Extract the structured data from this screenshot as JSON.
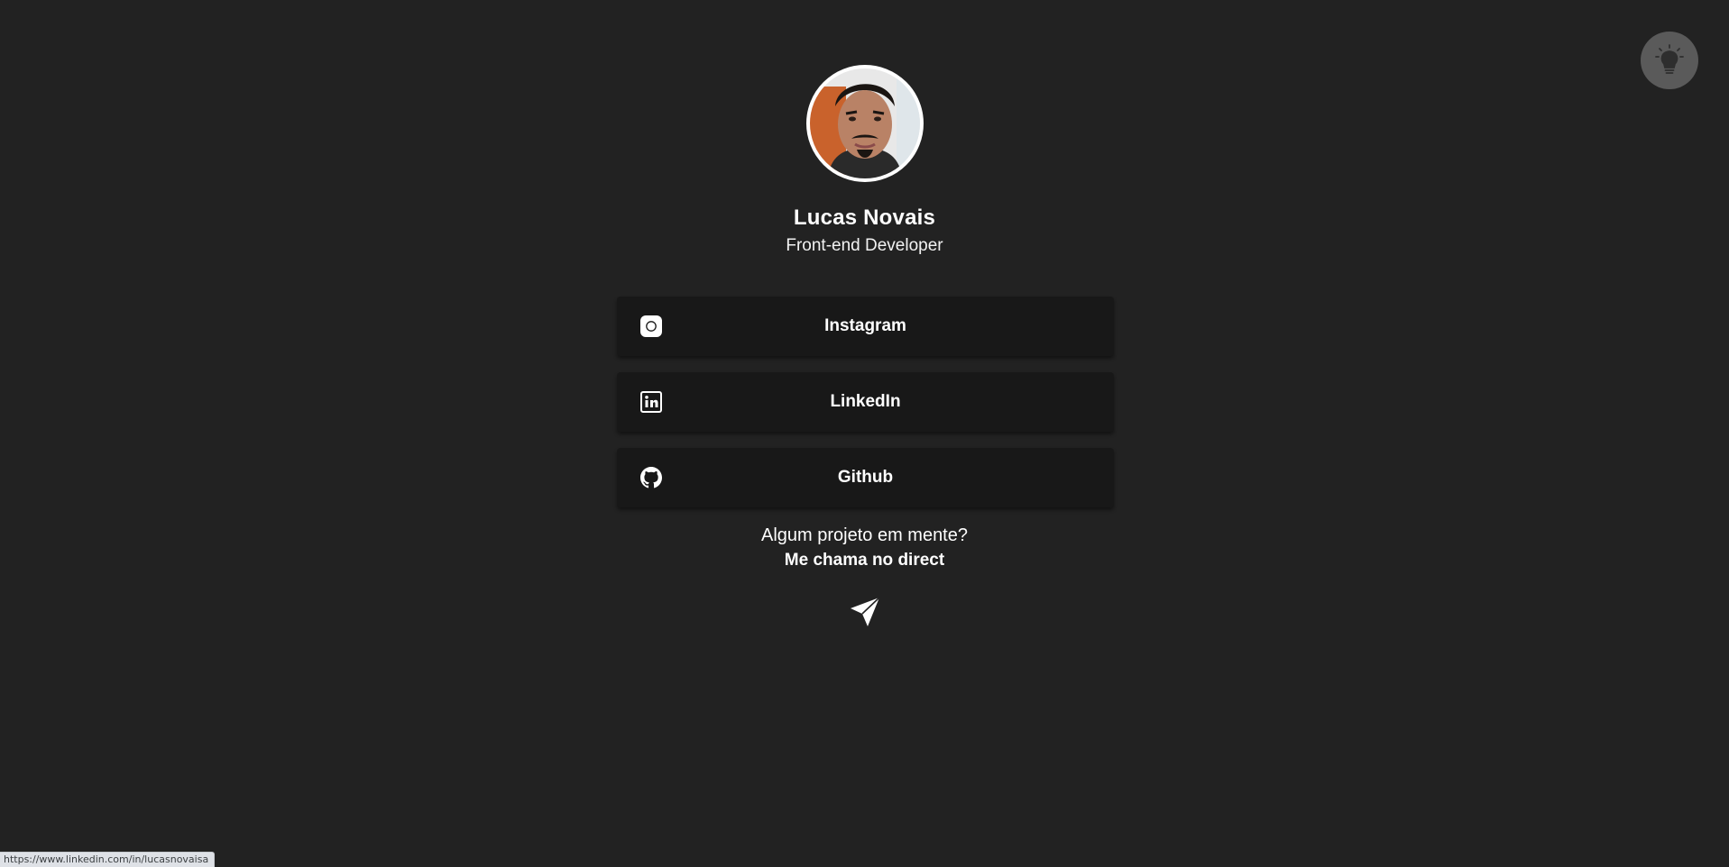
{
  "theme_toggle": {
    "icon": "lightbulb-icon"
  },
  "profile": {
    "name": "Lucas Novais",
    "role": "Front-end Developer"
  },
  "links": [
    {
      "label": "Instagram",
      "icon": "instagram-icon"
    },
    {
      "label": "LinkedIn",
      "icon": "linkedin-icon"
    },
    {
      "label": "Github",
      "icon": "github-icon"
    }
  ],
  "cta": {
    "question": "Algum projeto em mente?",
    "action": "Me chama no direct",
    "icon": "send-icon"
  },
  "status_bar": {
    "url": "https://www.linkedin.com/in/lucasnovaisa"
  },
  "colors": {
    "background": "#222222",
    "button": "#181818",
    "text": "#ffffff",
    "toggle": "#5a5a5a"
  }
}
